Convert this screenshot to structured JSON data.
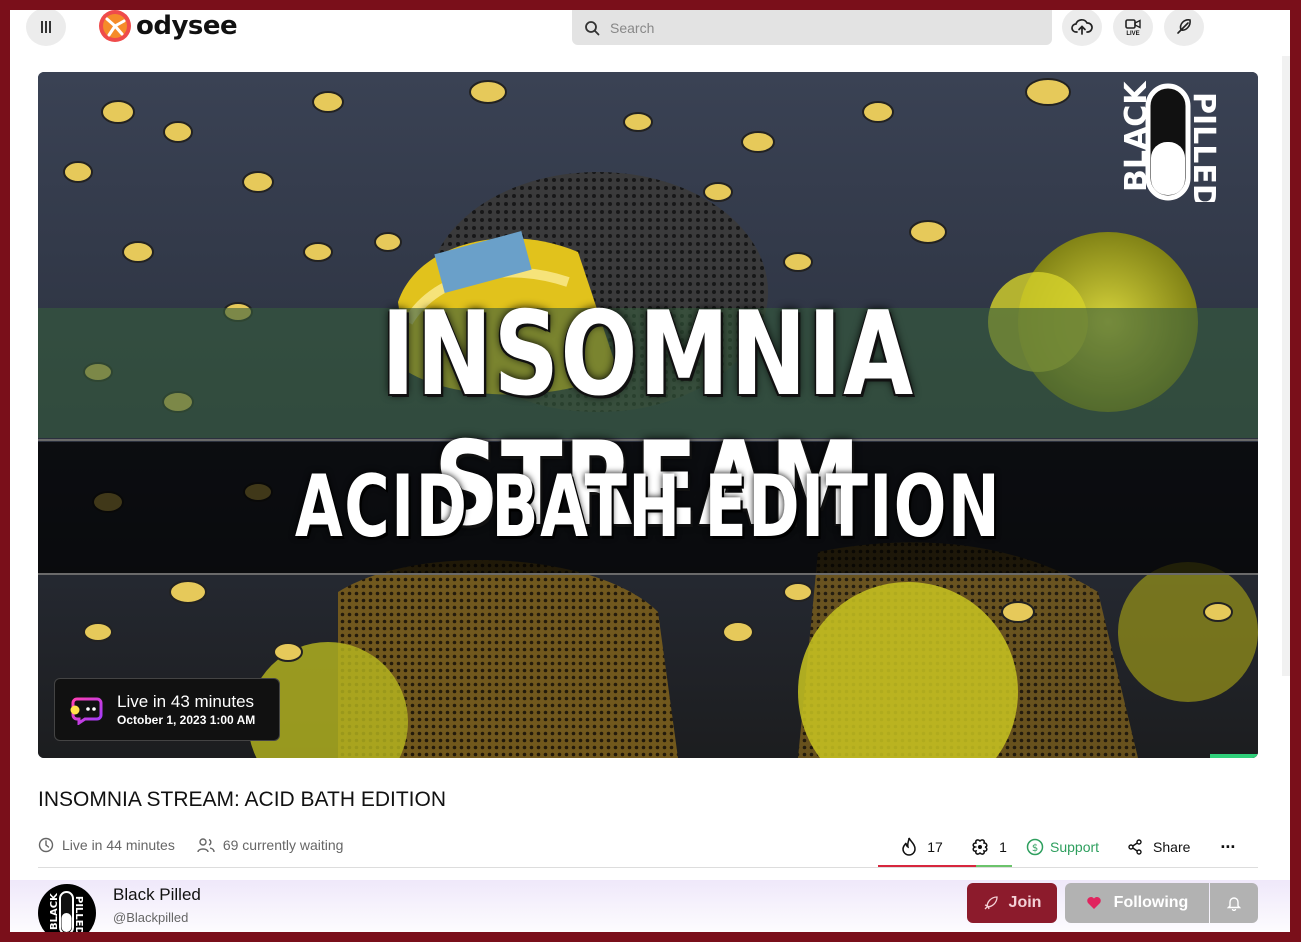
{
  "header": {
    "logo_text": "odysee",
    "search_placeholder": "Search",
    "live_badge": "LIVE"
  },
  "thumbnail": {
    "headline": "INSOMNIA STREAM",
    "subheadline": "ACID BATH EDITION",
    "brand_left": "BLACK",
    "brand_right": "PILLED"
  },
  "live_notice": {
    "main": "Live in 43 minutes",
    "date": "October 1, 2023 1:00 AM"
  },
  "video": {
    "title": "INSOMNIA STREAM: ACID BATH EDITION",
    "live_in": "Live in 44 minutes",
    "waiting": "69 currently waiting"
  },
  "actions": {
    "fire_count": "17",
    "slime_count": "1",
    "support_label": "Support",
    "share_label": "Share",
    "more_label": "···"
  },
  "channel": {
    "name": "Black Pilled",
    "handle": "@Blackpilled",
    "avatar_left": "BLACK",
    "avatar_right": "PILLED",
    "join_label": "Join",
    "follow_label": "Following"
  },
  "colors": {
    "frame": "#7a0f1a",
    "support_green": "#2e9f5e",
    "join_bg": "#8c1b2c",
    "fire_bar": "#d7263d",
    "slime_bar": "#6bc36b"
  }
}
